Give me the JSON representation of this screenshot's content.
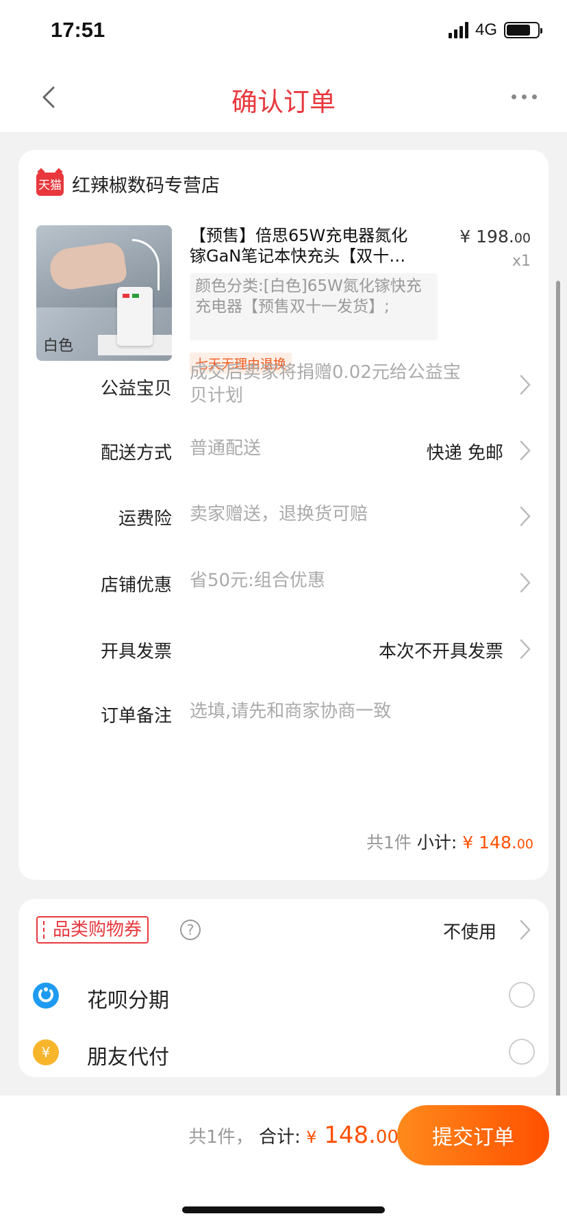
{
  "status_bar": {
    "time": "17:51",
    "network": "4G"
  },
  "navbar": {
    "title": "确认订单"
  },
  "shop": {
    "badge": "天猫",
    "name": "红辣椒数码专营店"
  },
  "product": {
    "title": "【预售】倍思65W充电器氮化镓GaN笔记本快充头【双十…",
    "image_label": "白色",
    "price_int": "¥ 198.",
    "price_dec": "00",
    "quantity": "x1",
    "sku": "颜色分类:[白色]65W氮化镓快充充电器【预售双十一发货】;",
    "return_tag": "七天无理由退换"
  },
  "rows": {
    "charity": {
      "label": "公益宝贝",
      "value": "成交后卖家将捐赠0.02元给公益宝贝计划"
    },
    "delivery": {
      "label": "配送方式",
      "value": "普通配送",
      "right": "快递 免邮"
    },
    "insurance": {
      "label": "运费险",
      "value": "卖家赠送，退换货可赔"
    },
    "discount": {
      "label": "店铺优惠",
      "value": "省50元:组合优惠"
    },
    "invoice": {
      "label": "开具发票",
      "right": "本次不开具发票"
    },
    "note": {
      "label": "订单备注",
      "placeholder": "选填,请先和商家协商一致"
    }
  },
  "subtotal": {
    "count": "共1件",
    "label": "小计:",
    "amount_int": "¥ 148.",
    "amount_dec": "00"
  },
  "coupon": {
    "tag": "品类购物券",
    "help": "?",
    "value": "不使用"
  },
  "payment_options": [
    {
      "label": "花呗分期",
      "icon": "huabei-icon",
      "color": "#1e9bf0"
    },
    {
      "label": "朋友代付",
      "icon": "yuan-coin-icon",
      "color": "#f7b52c"
    }
  ],
  "bottom": {
    "count": "共1件，",
    "total_label": "合计:",
    "currency": "¥",
    "amount_int": " 148.",
    "amount_dec": "00",
    "submit": "提交订单"
  },
  "colors": {
    "accent": "#e8383d",
    "price": "#ff5000"
  }
}
